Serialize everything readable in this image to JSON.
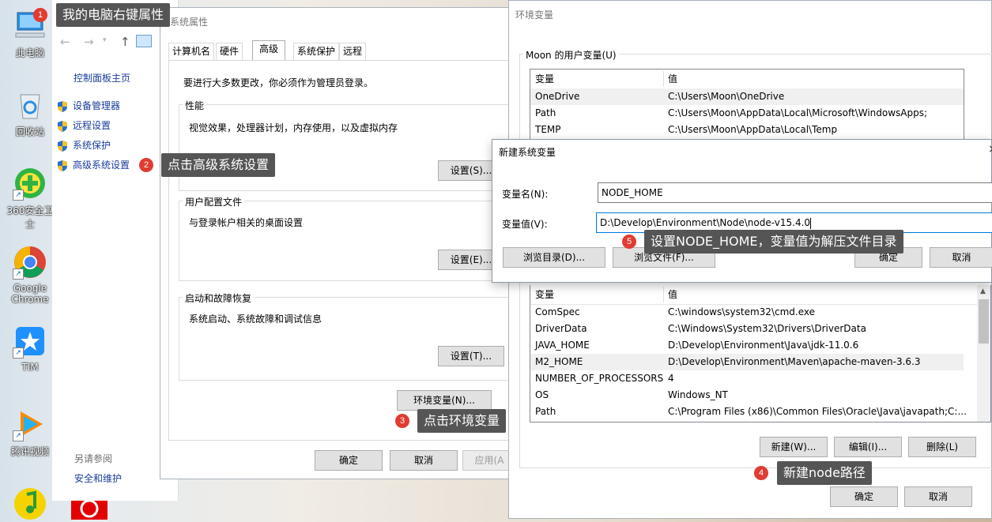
{
  "desktop": {
    "icons": [
      {
        "label": "此电脑"
      },
      {
        "label": "回收站"
      },
      {
        "label": "360安全卫士"
      },
      {
        "label": "Google Chrome"
      },
      {
        "label": "TIM"
      },
      {
        "label": "腾讯视频"
      }
    ]
  },
  "control_panel": {
    "home": "控制面板主页",
    "links": [
      "设备管理器",
      "远程设置",
      "系统保护",
      "高级系统设置"
    ],
    "see_also": "另请参阅",
    "security": "安全和维护"
  },
  "sys_props": {
    "title": "系统属性",
    "tabs": [
      "计算机名",
      "硬件",
      "高级",
      "系统保护",
      "远程"
    ],
    "admin_note": "要进行大多数更改，你必须作为管理员登录。",
    "perf": {
      "label": "性能",
      "desc": "视觉效果，处理器计划，内存使用，以及虚拟内存",
      "btn": "设置(S)..."
    },
    "profile": {
      "label": "用户配置文件",
      "desc": "与登录帐户相关的桌面设置",
      "btn": "设置(E)..."
    },
    "startup": {
      "label": "启动和故障恢复",
      "desc": "系统启动、系统故障和调试信息",
      "btn": "设置(T)..."
    },
    "env_btn": "环境变量(N)...",
    "ok": "确定",
    "cancel": "取消",
    "apply": "应用(A"
  },
  "env_vars": {
    "title": "环境变量",
    "user_group": "Moon 的用户变量(U)",
    "col_var": "变量",
    "col_val": "值",
    "user_rows": [
      {
        "name": "OneDrive",
        "value": "C:\\Users\\Moon\\OneDrive"
      },
      {
        "name": "Path",
        "value": "C:\\Users\\Moon\\AppData\\Local\\Microsoft\\WindowsApps;"
      },
      {
        "name": "TEMP",
        "value": "C:\\Users\\Moon\\AppData\\Local\\Temp"
      }
    ],
    "sys_rows": [
      {
        "name": "ComSpec",
        "value": "C:\\windows\\system32\\cmd.exe"
      },
      {
        "name": "DriverData",
        "value": "C:\\Windows\\System32\\Drivers\\DriverData"
      },
      {
        "name": "JAVA_HOME",
        "value": "D:\\Develop\\Environment\\Java\\jdk-11.0.6"
      },
      {
        "name": "M2_HOME",
        "value": "D:\\Develop\\Environment\\Maven\\apache-maven-3.6.3"
      },
      {
        "name": "NUMBER_OF_PROCESSORS",
        "value": "4"
      },
      {
        "name": "OS",
        "value": "Windows_NT"
      },
      {
        "name": "Path",
        "value": "C:\\Program Files (x86)\\Common Files\\Oracle\\Java\\javapath;C:..."
      }
    ],
    "new_btn": "新建(W)...",
    "edit_btn": "编辑(I)...",
    "delete_btn": "删除(L)",
    "ok": "确定",
    "cancel": "取消"
  },
  "new_var": {
    "title": "新建系统变量",
    "name_label": "变量名(N):",
    "name_value": "NODE_HOME",
    "value_label": "变量值(V):",
    "value_value": "D:\\Develop\\Environment\\Node\\node-v15.4.0",
    "browse_dir": "浏览目录(D)...",
    "browse_file": "浏览文件(F)...",
    "ok": "确定",
    "cancel": "取消"
  },
  "annotations": [
    {
      "num": "1",
      "text": "我的电脑右键属性"
    },
    {
      "num": "2",
      "text": "点击高级系统设置"
    },
    {
      "num": "3",
      "text": "点击环境变量"
    },
    {
      "num": "4",
      "text": "新建node路径"
    },
    {
      "num": "5",
      "text": "设置NODE_HOME，变量值为解压文件目录"
    }
  ],
  "colors": {
    "badge": "#e03c31",
    "note_bg": "#555555",
    "focus": "#0078d7"
  }
}
